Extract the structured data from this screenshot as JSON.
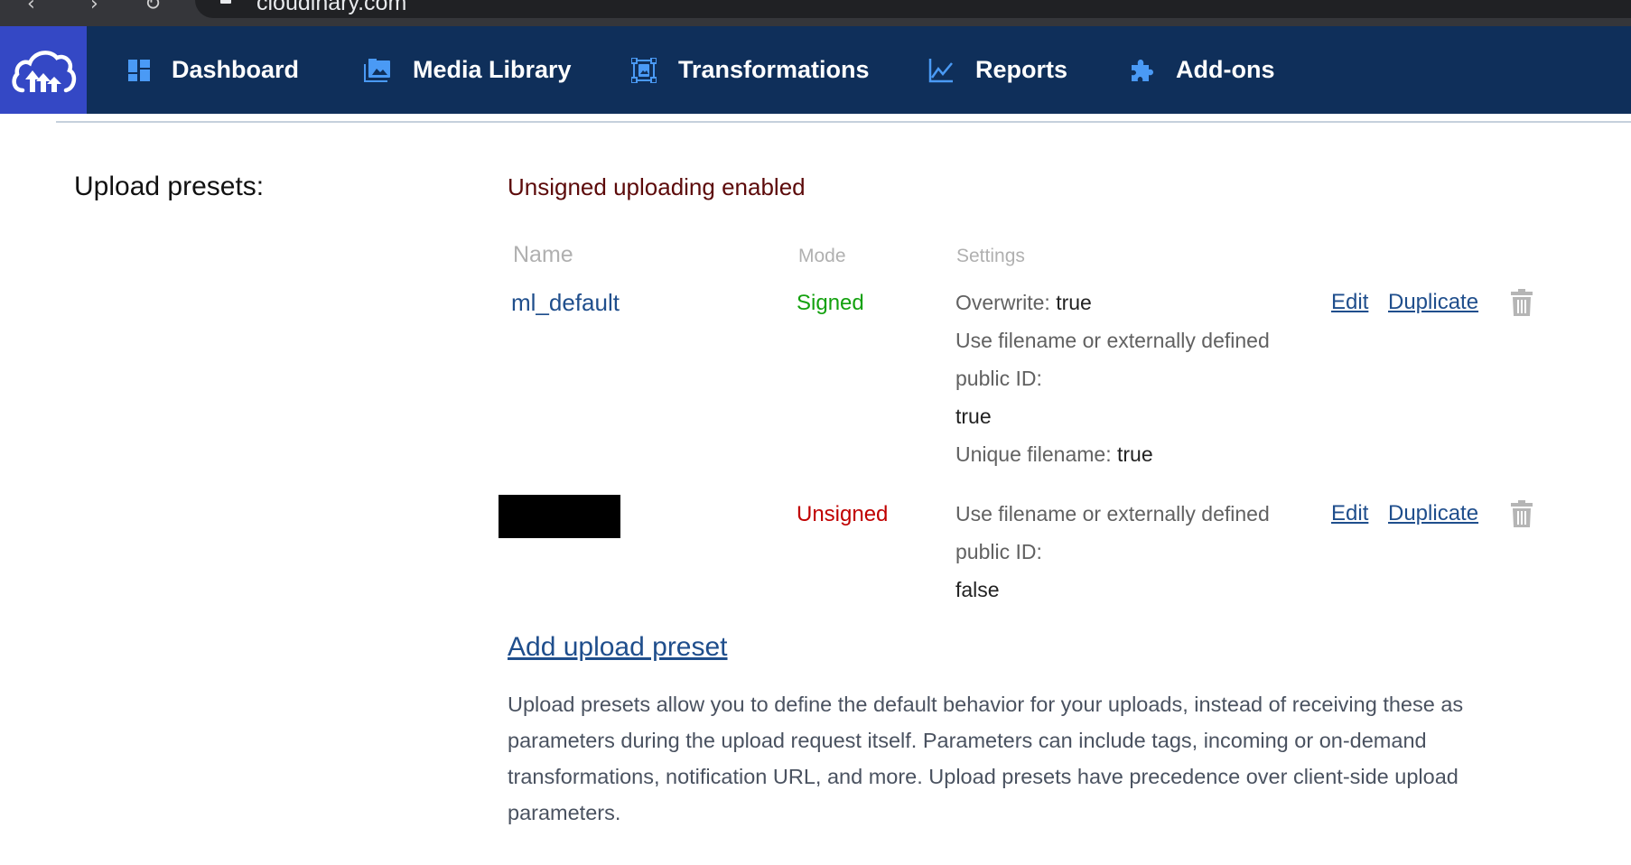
{
  "browser": {
    "url": "cloudinary.com"
  },
  "navbar": {
    "logo": "cloudinary-logo",
    "items": [
      {
        "label": "Dashboard",
        "icon": "dashboard-icon"
      },
      {
        "label": "Media Library",
        "icon": "media-library-icon"
      },
      {
        "label": "Transformations",
        "icon": "transformations-icon"
      },
      {
        "label": "Reports",
        "icon": "reports-chart-icon"
      },
      {
        "label": "Add-ons",
        "icon": "puzzle-piece-icon"
      }
    ]
  },
  "upload_presets": {
    "section_label": "Upload presets:",
    "unsigned_status": "Unsigned uploading enabled",
    "columns": {
      "name": "Name",
      "mode": "Mode",
      "settings": "Settings"
    },
    "rows": [
      {
        "name": "ml_default",
        "mode": "Signed",
        "settings": [
          {
            "label": "Overwrite:",
            "value": "true"
          },
          {
            "label": "Use filename or externally defined public ID:",
            "value": "true"
          },
          {
            "label": "Unique filename:",
            "value": "true"
          }
        ],
        "edit_label": "Edit",
        "duplicate_label": "Duplicate"
      },
      {
        "name": "[redacted]",
        "mode": "Unsigned",
        "settings": [
          {
            "label": "Use filename or externally defined public ID:",
            "value": "false"
          }
        ],
        "edit_label": "Edit",
        "duplicate_label": "Duplicate"
      }
    ],
    "add_preset_label": "Add upload preset",
    "description": "Upload presets allow you to define the default behavior for your uploads, instead of receiving these as parameters during the upload request itself. Parameters can include tags, incoming or on-demand transformations, notification URL, and more. Upload presets have precedence over client-side upload parameters."
  },
  "colors": {
    "navbar_bg": "#0f2f5a",
    "logo_bg": "#3448c5",
    "nav_icon": "#4a9af5",
    "link": "#1f4e8c",
    "signed": "#13a10e",
    "unsigned": "#c00000",
    "unsigned_status": "#5c0a0a"
  }
}
